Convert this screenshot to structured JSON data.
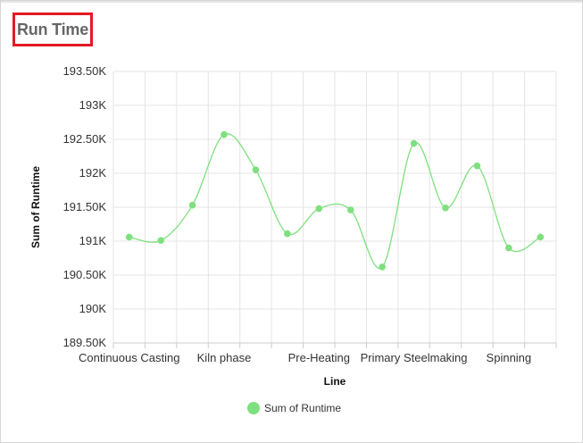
{
  "title": "Run Time",
  "chart_data": {
    "type": "line",
    "smooth": true,
    "categories": [
      "Continuous Casting",
      "",
      "",
      "Kiln phase",
      "",
      "",
      "Pre-Heating",
      "",
      "",
      "Primary Steelmaking",
      "",
      "",
      "Spinning",
      ""
    ],
    "series": [
      {
        "name": "Sum of Runtime",
        "color": "#7ee07e",
        "values": [
          191060,
          191010,
          191530,
          192570,
          192050,
          191110,
          191480,
          191460,
          190620,
          192440,
          191490,
          192110,
          190900,
          191060
        ]
      }
    ],
    "xlabel": "Line",
    "ylabel": "Sum of Runtime",
    "ylim": [
      189500,
      193500
    ],
    "yticks": [
      "189.50K",
      "190K",
      "190.50K",
      "191K",
      "191.50K",
      "192K",
      "192.50K",
      "193K",
      "193.50K"
    ],
    "grid": true,
    "legend_position": "bottom"
  }
}
